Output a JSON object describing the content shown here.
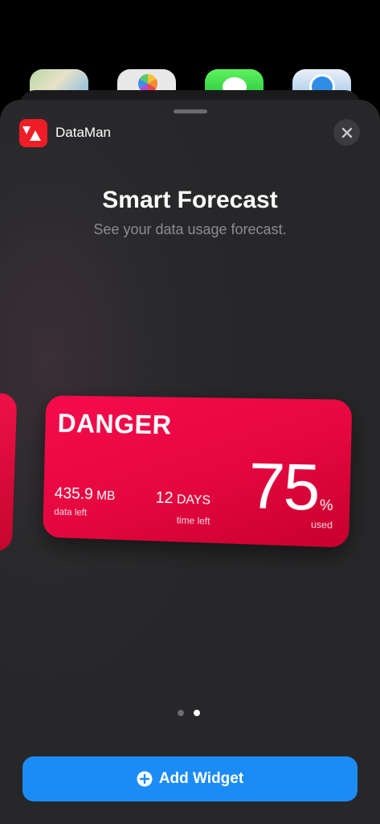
{
  "background_icons": [
    {
      "icon": "maps-icon"
    },
    {
      "icon": "photos-icon"
    },
    {
      "icon": "messages-icon"
    },
    {
      "icon": "safari-icon"
    }
  ],
  "sheet": {
    "app_name": "DataMan",
    "app_icon": "dataman-logo",
    "close_icon": "close-icon"
  },
  "gallery": {
    "title": "Smart Forecast",
    "subtitle": "See your data usage forecast."
  },
  "widget": {
    "status": "DANGER",
    "data_left_value": "435.9",
    "data_left_unit": "MB",
    "data_left_label": "data left",
    "time_left_value": "12",
    "time_left_unit": "DAYS",
    "time_left_label": "time left",
    "used_percent": "75",
    "used_sign": "%",
    "used_label": "used",
    "accent_color": "#ec0a45"
  },
  "pager": {
    "page_count": 2,
    "current_page": 2
  },
  "add_button": {
    "label": "Add Widget",
    "icon": "plus-circle-icon",
    "color": "#1c8cf5"
  }
}
